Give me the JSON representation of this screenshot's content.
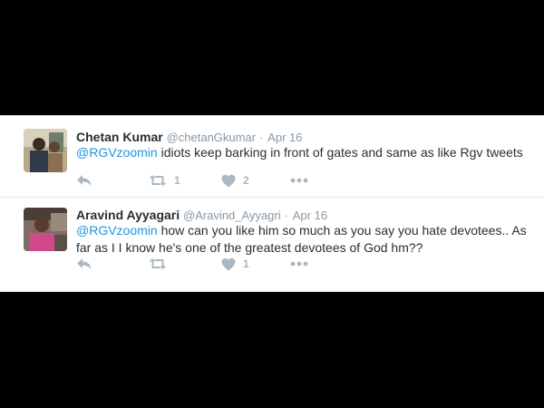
{
  "colors": {
    "background": "#000000",
    "card": "#ffffff",
    "name": "#292f33",
    "secondary": "#8899a6",
    "mention": "#1b95e0",
    "action_icon": "#aab8c2"
  },
  "tweets": [
    {
      "fullname": "Chetan Kumar",
      "username": "@chetanGkumar",
      "separator": "·",
      "time": "Apr 16",
      "mention": "@RGVzoomin",
      "text": " idiots keep barking in front of gates and same as like Rgv tweets",
      "actions": {
        "reply_icon": "reply-icon",
        "retweet_icon": "retweet-icon",
        "retweet_count": "1",
        "like_icon": "heart-icon",
        "like_count": "2",
        "more_icon": "more-dots-icon"
      }
    },
    {
      "fullname": "Aravind Ayyagari",
      "username": "@Aravind_Ayyagri",
      "separator": "·",
      "time": "Apr 16",
      "mention": "@RGVzoomin",
      "text": " how can you like him so much as you say you hate devotees.. As far as I I know he's one of the greatest devotees of God hm??",
      "actions": {
        "reply_icon": "reply-icon",
        "retweet_icon": "retweet-icon",
        "retweet_count": "",
        "like_icon": "heart-icon",
        "like_count": "1",
        "more_icon": "more-dots-icon"
      }
    }
  ]
}
